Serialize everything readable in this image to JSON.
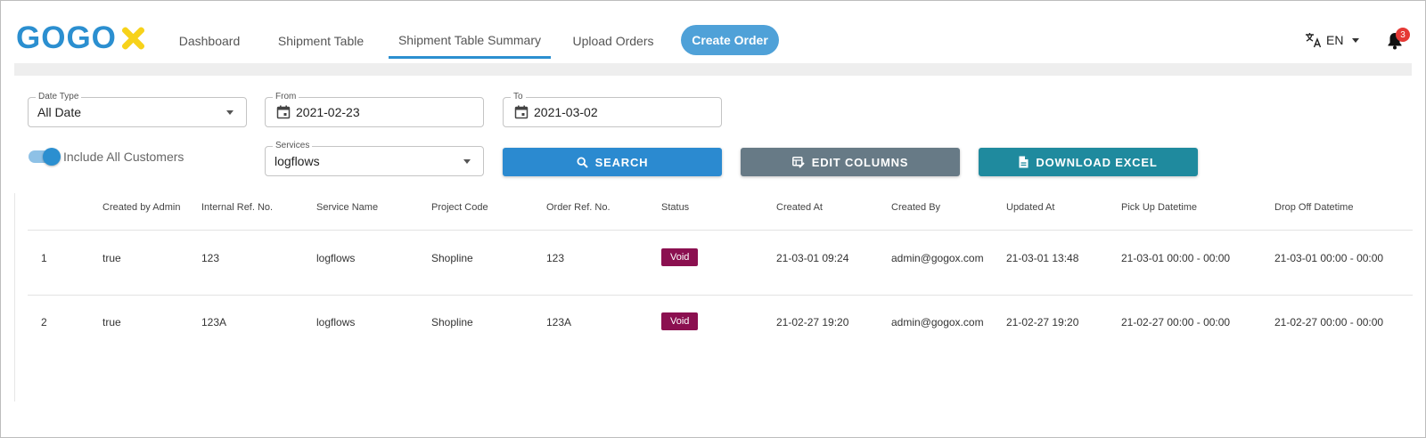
{
  "brand": {
    "logo_text": "GOGO",
    "logo_x": "X",
    "primary_color": "#2b8fd0",
    "accent_color": "#f7d21a"
  },
  "nav": {
    "items": [
      {
        "label": "Dashboard"
      },
      {
        "label": "Shipment Table"
      },
      {
        "label": "Shipment Table Summary",
        "active": true
      },
      {
        "label": "Upload Orders"
      }
    ],
    "create_order": "Create Order"
  },
  "header": {
    "language": "EN",
    "notification_count": "3"
  },
  "filters": {
    "date_type": {
      "label": "Date Type",
      "value": "All Date"
    },
    "from": {
      "label": "From",
      "value": "2021-02-23"
    },
    "to": {
      "label": "To",
      "value": "2021-03-02"
    },
    "services": {
      "label": "Services",
      "value": "logflows"
    },
    "include_all_customers": {
      "label": "Include All Customers",
      "checked": true
    }
  },
  "actions": {
    "search": "SEARCH",
    "edit_columns": "EDIT COLUMNS",
    "download_excel": "DOWNLOAD EXCEL"
  },
  "table": {
    "columns": [
      "Created by Admin",
      "Internal Ref. No.",
      "Service Name",
      "Project Code",
      "Order Ref. No.",
      "Status",
      "Created At",
      "Created By",
      "Updated At",
      "Pick Up Datetime",
      "Drop Off Datetime"
    ],
    "rows": [
      [
        "1",
        "true",
        "123",
        "logflows",
        "Shopline",
        "123",
        "Void",
        "21-03-01 09:24",
        "admin@gogox.com",
        "21-03-01 13:48",
        "21-03-01 00:00 - 00:00",
        "21-03-01 00:00 - 00:00"
      ],
      [
        "2",
        "true",
        "123A",
        "logflows",
        "Shopline",
        "123A",
        "Void",
        "21-02-27 19:20",
        "admin@gogox.com",
        "21-02-27 19:20",
        "21-02-27 00:00 - 00:00",
        "21-02-27 00:00 - 00:00"
      ]
    ],
    "status_color": "#8b1050"
  }
}
